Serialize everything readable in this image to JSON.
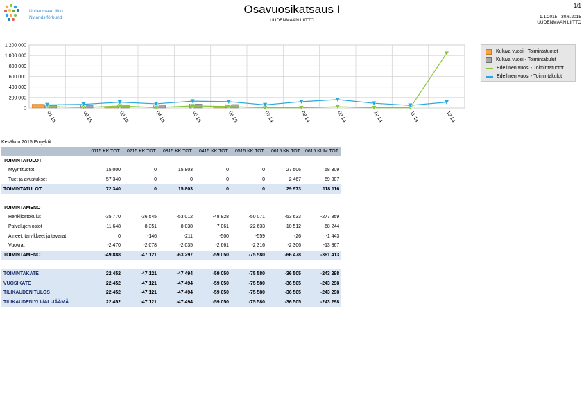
{
  "header": {
    "logo_line1": "Uudenmaan liitto",
    "logo_line2": "Nylands förbund",
    "title": "Osavuosikatsaus I",
    "subtitle": "UUDENMAAN LIITTO",
    "page": "1/1",
    "period": "1.1.2015 - 30.6.2015",
    "org": "UUDENMAAN LIITTO"
  },
  "colors": {
    "bar_current_income": "#f4a547",
    "bar_current_expense": "#a6a6a6",
    "line_prev_income": "#8bc33f",
    "line_prev_expense": "#29a8e0"
  },
  "chart_data": {
    "type": "bar",
    "categories": [
      "01 15",
      "02 15",
      "03 15",
      "04 15",
      "05 15",
      "06 15",
      "07 14",
      "08 14",
      "09 14",
      "10 14",
      "11 14",
      "12 14"
    ],
    "series": [
      {
        "name": "Kuluva vuosi - Toimintatuotot",
        "type": "bar",
        "values": [
          72340,
          0,
          15803,
          0,
          0,
          29973,
          null,
          null,
          null,
          null,
          null,
          null
        ]
      },
      {
        "name": "Kuluva vuosi - Toimintakulut",
        "type": "bar",
        "values": [
          49888,
          47121,
          63297,
          59050,
          75580,
          66478,
          null,
          null,
          null,
          null,
          null,
          null
        ]
      },
      {
        "name": "Edellinen vuosi - Toimintatuotot",
        "type": "line",
        "values": [
          30000,
          10000,
          40000,
          10000,
          40000,
          30000,
          5000,
          5000,
          25000,
          5000,
          5000,
          1040000
        ]
      },
      {
        "name": "Edellinen vuosi - Toimintakulut",
        "type": "line",
        "values": [
          60000,
          70000,
          110000,
          80000,
          130000,
          120000,
          60000,
          120000,
          160000,
          90000,
          50000,
          110000
        ]
      }
    ],
    "ylim": [
      0,
      1200000
    ],
    "yticks": [
      "0",
      "200 000",
      "400 000",
      "600 000",
      "800 000",
      "1 000 000",
      "1 200 000"
    ],
    "grid": true,
    "legend": "right"
  },
  "report": {
    "caption": "Kesäkuu 2015 Projektit",
    "columns": [
      "",
      "0115 KK TOT.",
      "0215 KK TOT.",
      "0315 KK TOT.",
      "0415 KK TOT.",
      "0515 KK TOT.",
      "0615 KK TOT.",
      "0615 KUM TOT."
    ],
    "rows": [
      {
        "kind": "group",
        "label": "TOIMINTATULOT",
        "values": []
      },
      {
        "kind": "item",
        "label": "Myyntituotot",
        "values": [
          "15 000",
          "0",
          "15 803",
          "0",
          "0",
          "27 506",
          "58 309"
        ]
      },
      {
        "kind": "item",
        "label": "Tuet ja avustukset",
        "values": [
          "57 340",
          "0",
          "0",
          "0",
          "0",
          "2 467",
          "59 807"
        ]
      },
      {
        "kind": "sum",
        "label": "TOIMINTATULOT",
        "values": [
          "72 340",
          "0",
          "15 803",
          "0",
          "0",
          "29 973",
          "118 116"
        ]
      },
      {
        "kind": "blank",
        "label": "",
        "values": []
      },
      {
        "kind": "group",
        "label": "TOIMINTAMENOT",
        "values": []
      },
      {
        "kind": "item",
        "label": "Henkilöstökulut",
        "values": [
          "-35 770",
          "-36 545",
          "-53 012",
          "-48 828",
          "-50 071",
          "-53 633",
          "-277 859"
        ]
      },
      {
        "kind": "item",
        "label": "Palvelujen ostot",
        "values": [
          "-11 648",
          "-8 351",
          "-8 038",
          "-7 061",
          "-22 633",
          "-10 512",
          "-68 244"
        ]
      },
      {
        "kind": "item",
        "label": "Aineet, tarvikkeet ja tavarat",
        "values": [
          "0",
          "-146",
          "-211",
          "-500",
          "-559",
          "-26",
          "-1 443"
        ]
      },
      {
        "kind": "item",
        "label": "Vuokrat",
        "values": [
          "-2 470",
          "-2 078",
          "-2 035",
          "-2 661",
          "-2 316",
          "-2 306",
          "-13 867"
        ]
      },
      {
        "kind": "sum",
        "label": "TOIMINTAMENOT",
        "values": [
          "-49 888",
          "-47 121",
          "-63 297",
          "-59 050",
          "-75 580",
          "-66 478",
          "-361 413"
        ]
      },
      {
        "kind": "blank",
        "label": "",
        "values": []
      },
      {
        "kind": "hl",
        "label": "TOIMINTAKATE",
        "values": [
          "22 452",
          "-47 121",
          "-47 494",
          "-59 050",
          "-75 580",
          "-36 505",
          "-243 298"
        ]
      },
      {
        "kind": "hl",
        "label": "VUOSIKATE",
        "values": [
          "22 452",
          "-47 121",
          "-47 494",
          "-59 050",
          "-75 580",
          "-36 505",
          "-243 298"
        ]
      },
      {
        "kind": "hl",
        "label": "TILIKAUDEN TULOS",
        "values": [
          "22 452",
          "-47 121",
          "-47 494",
          "-59 050",
          "-75 580",
          "-36 505",
          "-243 298"
        ]
      },
      {
        "kind": "hl",
        "label": "TILIKAUDEN YLI-/ALIJÄÄMÄ",
        "values": [
          "22 452",
          "-47 121",
          "-47 494",
          "-59 050",
          "-75 580",
          "-36 505",
          "-243 298"
        ]
      }
    ]
  }
}
